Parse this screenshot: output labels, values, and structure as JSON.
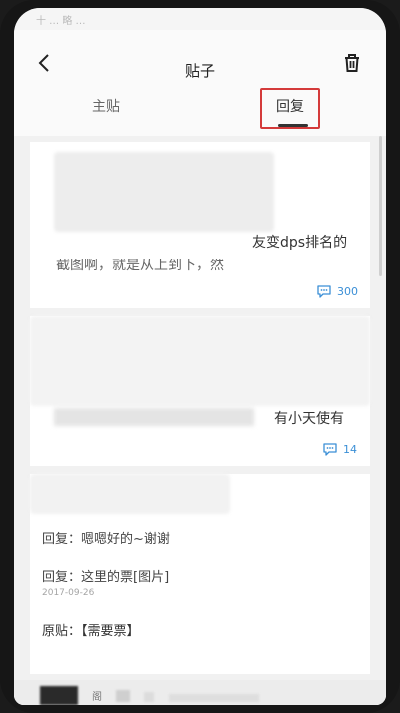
{
  "status_bar": {
    "text": "十 … 略 …"
  },
  "header": {
    "title": "贴子"
  },
  "tabs": [
    {
      "label": "主贴"
    },
    {
      "label": "回复"
    }
  ],
  "posts": [
    {
      "line1": "友变dps排名的",
      "line2": "截图啊，就是从上到下，然",
      "comment_count": "300"
    },
    {
      "line1": "有小天使有",
      "comment_count": "14"
    }
  ],
  "reply_card": {
    "reply1": "回复：嗯嗯好的~谢谢",
    "reply2": "回复：这里的票[图片]",
    "date": "2017-09-26",
    "original": "原贴：【需要票】"
  },
  "bottom_bar": {
    "text": "阁"
  }
}
